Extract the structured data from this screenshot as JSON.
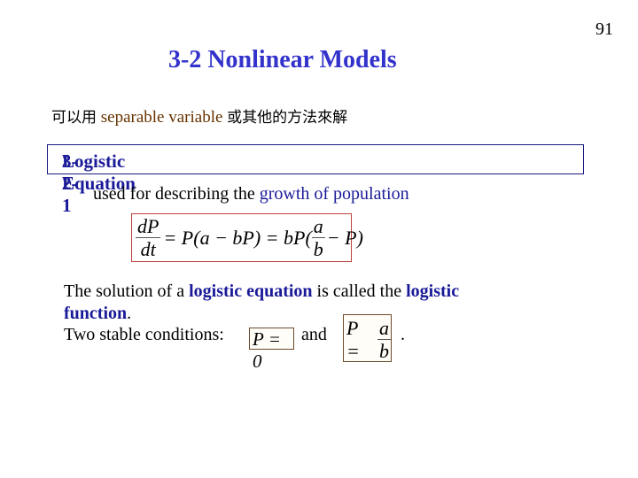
{
  "page_number": "91",
  "title": "3-2  Nonlinear Models",
  "intro": {
    "prefix_cn": "可以用",
    "method": "separable variable",
    "suffix_cn": "或其他的方法來解"
  },
  "section": {
    "number": "3-2-1",
    "name": "Logistic Equation"
  },
  "usage": {
    "text": "used for describing the",
    "highlight": "growth of population"
  },
  "equation": {
    "lhs_num": "dP",
    "lhs_den": "dt",
    "mid": "= P(a − bP) = bP(",
    "frac_num": "a",
    "frac_den": "b",
    "tail": "− P)"
  },
  "solution": {
    "part1": "The solution of a",
    "term1": "logistic equation",
    "part2": "is called the",
    "term2": "logistic function",
    "end": "."
  },
  "conditions": {
    "label": "Two stable conditions:",
    "cond1": "P = 0",
    "connector": "and",
    "cond2_lhs": "P =",
    "cond2_num": "a",
    "cond2_den": "b",
    "end": "."
  },
  "colors": {
    "title": "#3333cc",
    "section": "#1a1a99",
    "highlight": "#1a1a99",
    "method": "#663300",
    "equation_border": "#c04040",
    "condition_border": "#6b4a2a"
  }
}
